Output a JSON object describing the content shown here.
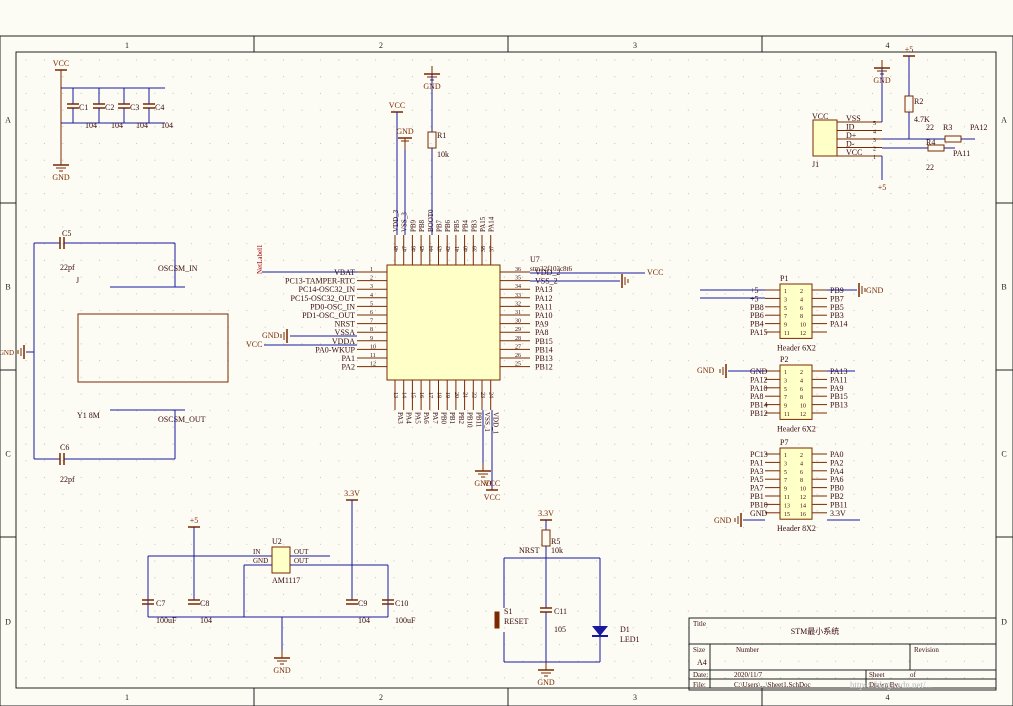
{
  "toolbar": [
    {
      "icon": "filter-icon"
    },
    {
      "icon": "crosshair-icon"
    },
    {
      "icon": "select-rect-icon"
    },
    {
      "icon": "align-icon"
    },
    {
      "icon": "place-part-icon"
    },
    {
      "icon": "place-bus-icon"
    },
    {
      "icon": "place-netlabel-icon"
    },
    {
      "icon": "place-port-icon"
    },
    {
      "icon": "place-sheet-icon"
    },
    {
      "icon": "place-designator-icon"
    },
    {
      "icon": "place-noerc-icon"
    },
    {
      "icon": "place-text-icon"
    },
    {
      "icon": "place-arc-icon"
    }
  ],
  "border": {
    "cols": [
      "1",
      "2",
      "3",
      "4"
    ],
    "rows": [
      "A",
      "B",
      "C",
      "D"
    ]
  },
  "title_block": {
    "title_label": "Title",
    "title": "STM最小系统",
    "size_label": "Size",
    "size": "A4",
    "number_label": "Number",
    "revision_label": "Revision",
    "date_label": "Date:",
    "date": "2020/11/7",
    "sheet_label": "Sheet",
    "of_label": "of",
    "file_label": "File:",
    "file": "C:\\Users\\...\\Sheet1.SchDoc",
    "drawn_label": "Drawn By:"
  },
  "watermark": "https://blog.csdn.net/...",
  "labels": {
    "vcc": "VCC",
    "gnd": "GND",
    "v33": "3.3V",
    "p5": "+5",
    "c1": "C1",
    "c2": "C2",
    "c3": "C3",
    "c4": "C4",
    "c104": "104",
    "c5": "C5",
    "c6": "C6",
    "c22pf": "22pf",
    "j": "J",
    "osc_in": "OSCSM_IN",
    "osc_out": "OSCSM_OUT",
    "y1": "Y1 8M",
    "r1": "R1",
    "r1v": "10k",
    "netlabel": "NetLabel1",
    "u7": "U7",
    "u7v": "stm32f103c8t6",
    "left_pins": [
      "VBAT",
      "PC13-TAMPER-RTC",
      "PC14-OSC32_IN",
      "PC15-OSC32_OUT",
      "PD0-OSC_IN",
      "PD1-OSC_OUT",
      "NRST",
      "VSSA",
      "VDDA",
      "PA0-WKUP",
      "PA1",
      "PA2"
    ],
    "left_nums": [
      "1",
      "2",
      "3",
      "4",
      "5",
      "6",
      "7",
      "8",
      "9",
      "10",
      "11",
      "12"
    ],
    "right_pins": [
      "VDD_2",
      "VSS_2",
      "PA13",
      "PA12",
      "PA11",
      "PA10",
      "PA9",
      "PA8",
      "PB15",
      "PB14",
      "PB13",
      "PB12"
    ],
    "right_nums": [
      "36",
      "35",
      "34",
      "33",
      "32",
      "31",
      "30",
      "29",
      "28",
      "27",
      "26",
      "25"
    ],
    "top_pins": [
      "VDD_3",
      "VSS_3",
      "PB9",
      "PB8",
      "BOOT0",
      "PB7",
      "PB6",
      "PB5",
      "PB4",
      "PB3",
      "PA15",
      "PA14"
    ],
    "top_nums": [
      "48",
      "47",
      "46",
      "45",
      "44",
      "43",
      "42",
      "41",
      "40",
      "39",
      "38",
      "37"
    ],
    "bot_pins": [
      "PA3",
      "PA4",
      "PA5",
      "PA6",
      "PA7",
      "PB0",
      "PB1",
      "PB2",
      "PB10",
      "PB11",
      "VSS_1",
      "VDD_1"
    ],
    "bot_nums": [
      "13",
      "14",
      "15",
      "16",
      "17",
      "18",
      "19",
      "20",
      "21",
      "22",
      "23",
      "24"
    ],
    "j1": "J1",
    "j1_vcc": "VCC",
    "j1_pins": [
      "VSS",
      "ID",
      "D+",
      "D-",
      "VCC"
    ],
    "j1_nums": [
      "5",
      "4",
      "3",
      "2",
      "1"
    ],
    "r2": "R2",
    "r2v": "4.7K",
    "r3": "R3",
    "r4": "R4",
    "r22": "22",
    "pa12": "PA12",
    "pa11": "PA11",
    "p1": "P1",
    "p2": "P2",
    "p7": "P7",
    "hdr6": "Header 6X2",
    "hdr8": "Header 8X2",
    "p1_left": [
      "+5",
      "+5",
      "PB8",
      "PB6",
      "PB4",
      "PA15"
    ],
    "p1_right": [
      "PB9",
      "PB7",
      "PB5",
      "PB3",
      "PA14",
      ""
    ],
    "p2_left": [
      "GND",
      "PA12",
      "PA10",
      "PA8",
      "PB14",
      "PB12"
    ],
    "p2_right": [
      "PA13",
      "PA11",
      "PA9",
      "PB15",
      "PB13",
      ""
    ],
    "p7_left": [
      "PC13",
      "PA1",
      "PA3",
      "PA5",
      "PA7",
      "PB1",
      "PB10",
      "GND"
    ],
    "p7_right": [
      "PA0",
      "PA2",
      "PA4",
      "PA6",
      "PB0",
      "PB2",
      "PB11",
      "3.3V"
    ],
    "u2": "U2",
    "u2v": "AM1117",
    "in": "IN",
    "gnd_pin": "GND",
    "out": "OUT",
    "c7": "C7",
    "c8": "C8",
    "c9": "C9",
    "c10": "C10",
    "c100uf": "100uF",
    "r5": "R5",
    "r5v": "10k",
    "nrst": "NRST",
    "s1": "S1",
    "reset": "RESET",
    "c11": "C11",
    "c105": "105",
    "d1": "D1",
    "led1": "LED1"
  }
}
